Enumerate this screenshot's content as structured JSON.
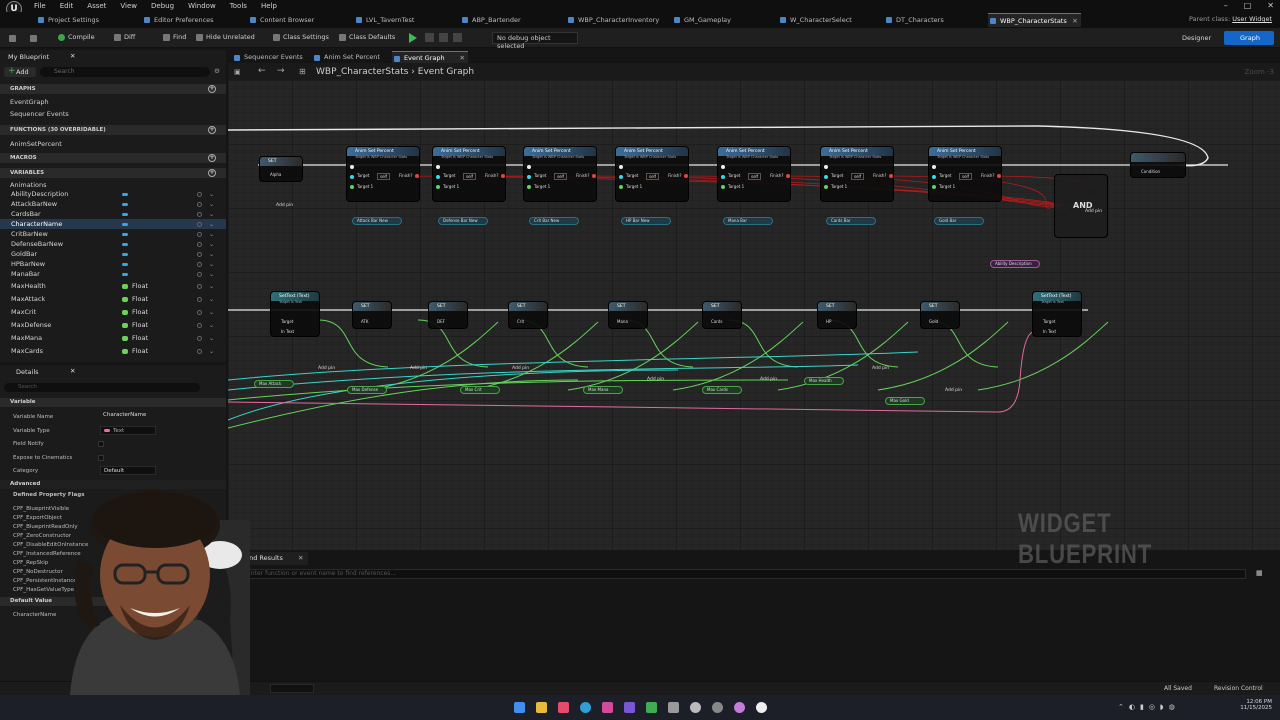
{
  "menubar": {
    "items": [
      "File",
      "Edit",
      "Asset",
      "View",
      "Debug",
      "Window",
      "Tools",
      "Help"
    ]
  },
  "tabs": [
    {
      "label": "Project Settings"
    },
    {
      "label": "Editor Preferences"
    },
    {
      "label": "Content Browser"
    },
    {
      "label": "LVL_TavernTest"
    },
    {
      "label": "ABP_Bartender"
    },
    {
      "label": "WBP_CharacterInventory"
    },
    {
      "label": "GM_Gameplay"
    },
    {
      "label": "W_CharacterSelect"
    },
    {
      "label": "DT_Characters"
    },
    {
      "label": "WBP_CharacterStats"
    }
  ],
  "parent_class": {
    "label": "Parent class:",
    "value": "User Widget"
  },
  "toolbar": {
    "compile": "Compile",
    "diff": "Diff",
    "find": "Find",
    "hide_unrelated": "Hide Unrelated",
    "class_settings": "Class Settings",
    "class_defaults": "Class Defaults",
    "debug_select": "No debug object selected",
    "designer": "Designer",
    "graph": "Graph"
  },
  "my_blueprint": {
    "title": "My Blueprint",
    "add": "Add",
    "search_placeholder": "Search",
    "graphs_header": "GRAPHS",
    "graphs": [
      "EventGraph",
      "Sequencer Events"
    ],
    "functions_header": "FUNCTIONS (30 OVERRIDABLE)",
    "functions": [
      "AnimSetPercent"
    ],
    "macros_header": "MACROS",
    "variables_header": "VARIABLES",
    "var_category": "Animations",
    "variables": [
      {
        "name": "AbilityDescription",
        "type": ""
      },
      {
        "name": "AttackBarNew",
        "type": ""
      },
      {
        "name": "CardsBar",
        "type": ""
      },
      {
        "name": "CharacterName",
        "type": ""
      },
      {
        "name": "CritBarNew",
        "type": ""
      },
      {
        "name": "DefenseBarNew",
        "type": ""
      },
      {
        "name": "GoldBar",
        "type": ""
      },
      {
        "name": "HPBarNew",
        "type": ""
      },
      {
        "name": "ManaBar",
        "type": ""
      },
      {
        "name": "MaxHealth",
        "type": "Float"
      },
      {
        "name": "MaxAttack",
        "type": "Float"
      },
      {
        "name": "MaxCrit",
        "type": "Float"
      },
      {
        "name": "MaxDefense",
        "type": "Float"
      },
      {
        "name": "MaxMana",
        "type": "Float"
      },
      {
        "name": "MaxCards",
        "type": "Float"
      }
    ]
  },
  "details": {
    "title": "Details",
    "search_placeholder": "Search",
    "variable_header": "Variable",
    "variable_name_label": "Variable Name",
    "variable_name": "CharacterName",
    "variable_type_label": "Variable Type",
    "variable_type": "Text",
    "field_notify": "Field Notify",
    "expose_cinematics": "Expose to Cinematics",
    "category_label": "Category",
    "category": "Default",
    "advanced": "Advanced",
    "defined_flags": "Defined Property Flags",
    "flags": [
      "CPF_BlueprintVisible",
      "CPF_ExportObject",
      "CPF_BlueprintReadOnly",
      "CPF_ZeroConstructor",
      "CPF_DisableEditOnInstance",
      "CPF_InstancedReference",
      "CPF_RepSkip",
      "CPF_NoDestructor",
      "CPF_PersistentInstance",
      "CPF_HasGetValueTypeHash"
    ],
    "default_value_header": "Default Value",
    "default_value_label": "CharacterName"
  },
  "graph_tabs": [
    "Sequencer Events",
    "Anim Set Percent",
    "Event Graph"
  ],
  "breadcrumb": {
    "root": "WBP_CharacterStats",
    "sep": "›",
    "leaf": "Event Graph"
  },
  "zoom": "Zoom -3",
  "watermark": "WIDGET BLUEPRINT",
  "nodes": {
    "anim_title": "Anim Set Percent",
    "anim_sub": "Target is WBP Character Stats",
    "target": "Target",
    "self": "self",
    "finish": "Finish?",
    "target1": "Target 1",
    "set": "SET",
    "alpha": "Alpha",
    "add_pin": "Add pin",
    "settext_title": "SetText (Text)",
    "settext_sub": "Target is Text",
    "in_text": "In Text",
    "and": "AND",
    "condition": "Condition",
    "ability_desc": "Ability Description",
    "anim_vars": [
      "Attack Bar New",
      "Defense Bar New",
      "Crit Bar New",
      "HP Bar New",
      "Mana Bar",
      "Cards Bar",
      "Gold Bar"
    ],
    "set_vars": [
      "ATK",
      "DEF",
      "Crit",
      "Mana",
      "Cards",
      "HP",
      "Gold"
    ],
    "max_vars": [
      "Max Attack",
      "Max Defense",
      "Max Crit",
      "Max Mana",
      "Max Cards",
      "Max Health",
      "Max Gold"
    ]
  },
  "find_results": {
    "title": "Find Results",
    "placeholder": "Enter function or event name to find references..."
  },
  "status": {
    "saved": "All Saved",
    "revision": "Revision Control"
  },
  "clock": {
    "time": "12:06 PM",
    "date": "11/15/2025"
  }
}
